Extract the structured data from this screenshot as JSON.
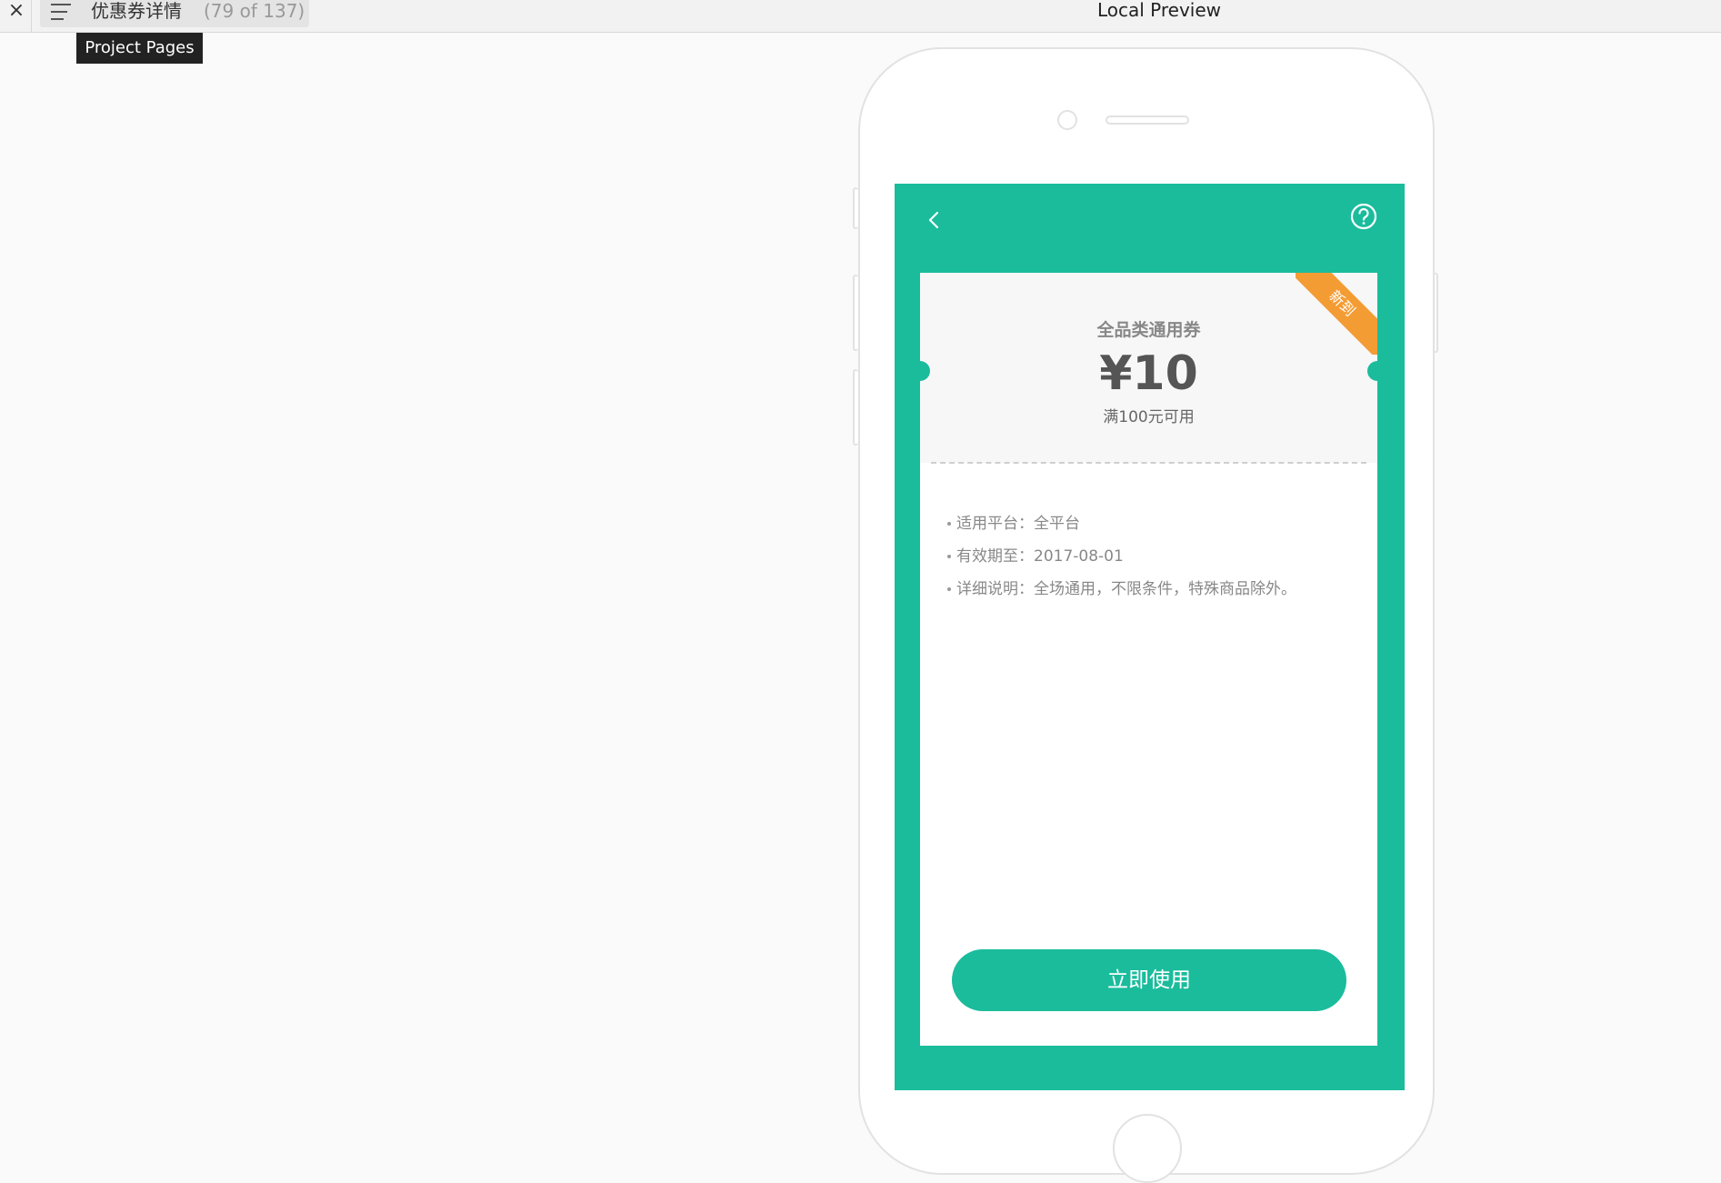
{
  "topbar": {
    "close_label": "×",
    "page_title": "优惠券详情",
    "page_count": "(79 of 137)",
    "preview_title": "Local Preview",
    "tooltip": "Project Pages"
  },
  "coupon": {
    "ribbon": "新到",
    "name": "全品类通用券",
    "value": "¥10",
    "condition": "满100元可用",
    "details": [
      "适用平台：全平台",
      "有效期至：2017-08-01",
      "详细说明：全场通用，不限条件，特殊商品除外。"
    ],
    "use_button": "立即使用"
  },
  "colors": {
    "accent": "#1abc9c",
    "ribbon": "#f39c34"
  },
  "icons": {
    "back": "chevron-left-icon",
    "help": "question-circle-icon",
    "menu": "hamburger-icon",
    "close": "close-icon"
  }
}
